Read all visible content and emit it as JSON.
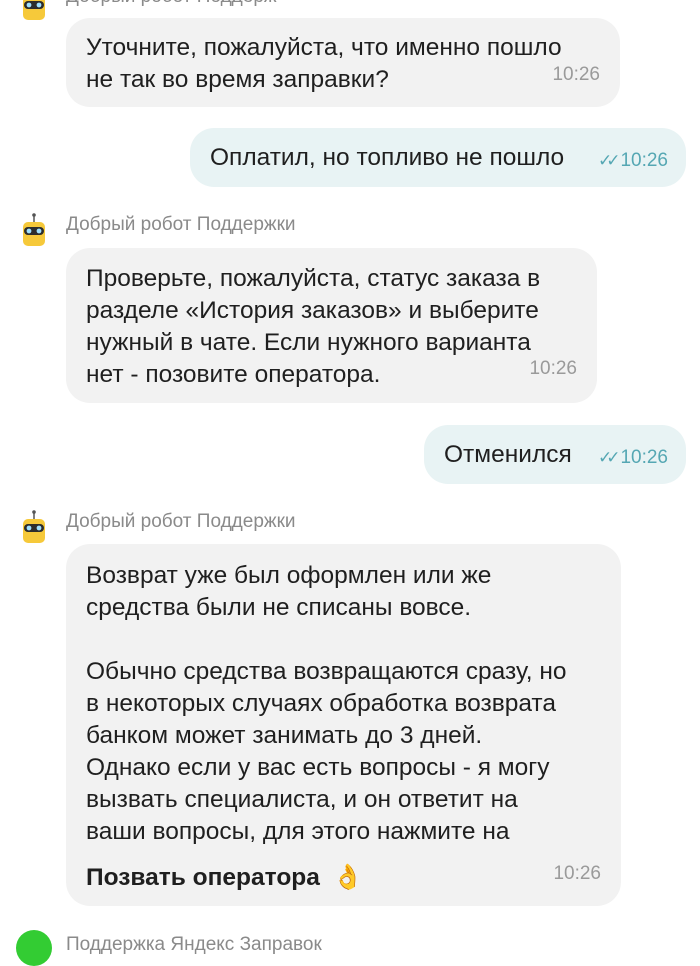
{
  "messages": [
    {
      "sender": "Добрый робот Поддерж",
      "text": "Уточните, пожалуйста, что именно пошло\nне так во время заправки?",
      "time": "10:26"
    },
    {
      "text": "Оплатил, но топливо не пошло",
      "time": "10:26",
      "status": "read"
    },
    {
      "sender": "Добрый робот Поддержки",
      "text": "Проверьте, пожалуйста, статус заказа в\nразделе «История заказов» и выберите\nнужный в чате. Если нужного варианта\nнет - позовите оператора.",
      "time": "10:26"
    },
    {
      "text": "Отменился",
      "time": "10:26",
      "status": "read"
    },
    {
      "sender": "Добрый робот Поддержки",
      "text": "Возврат уже был оформлен или же\nсредства были не списаны вовсе.\n\nОбычно средства возвращаются сразу, но\nв некоторых случаях обработка возврата\nбанком может занимать до 3 дней.\nОднако если у вас есть вопросы - я могу\nвызвать специалиста, и он ответит на\nваши вопросы, для этого нажмите на",
      "action": "Позвать оператора",
      "emoji": "👌",
      "time": "10:26"
    },
    {
      "sender": "Поддержка Яндекс Заправок"
    }
  ],
  "colors": {
    "incoming_bubble": "#f2f2f2",
    "outgoing_bubble": "#e8f3f4",
    "read_tick": "#55a7b3",
    "robot_avatar": "#f6c93a",
    "support_avatar": "#33cc33"
  }
}
